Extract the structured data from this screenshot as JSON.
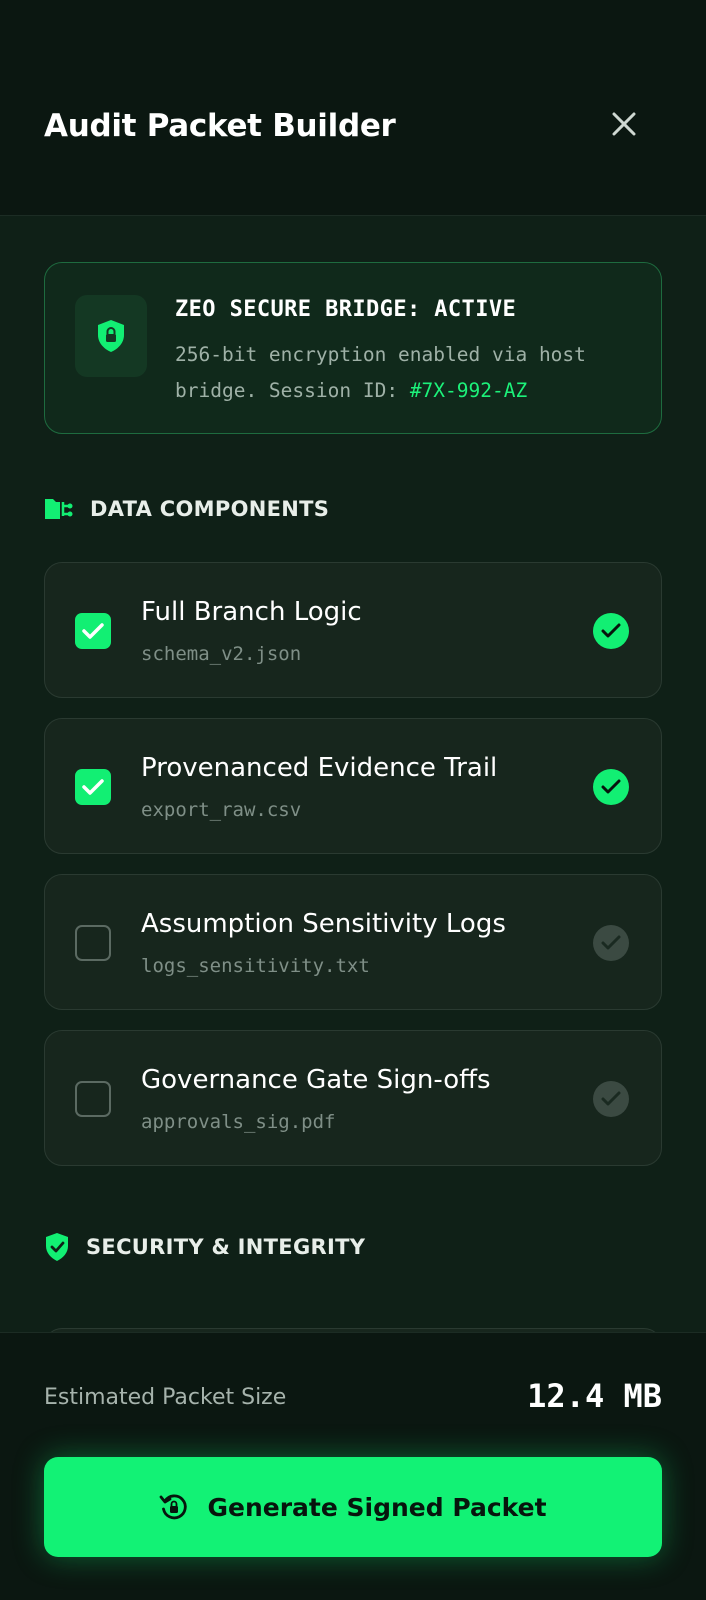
{
  "header": {
    "title": "Audit Packet Builder",
    "close_icon": "close-icon"
  },
  "bridge": {
    "title": "ZEO SECURE BRIDGE: ACTIVE",
    "description": "256-bit encryption enabled via host bridge. Session ID: ",
    "session_id": "#7X-992-AZ",
    "icon": "shield-lock-icon"
  },
  "sections": {
    "data_components": {
      "label": "DATA COMPONENTS",
      "icon": "folder-tree-icon"
    },
    "security": {
      "label": "SECURITY & INTEGRITY",
      "icon": "shield-check-icon"
    }
  },
  "components": [
    {
      "title": "Full Branch Logic",
      "file": "schema_v2.json",
      "checked": true
    },
    {
      "title": "Provenanced Evidence Trail",
      "file": "export_raw.csv",
      "checked": true
    },
    {
      "title": "Assumption Sensitivity Logs",
      "file": "logs_sensitivity.txt",
      "checked": false
    },
    {
      "title": "Governance Gate Sign-offs",
      "file": "approvals_sig.pdf",
      "checked": false
    }
  ],
  "footer": {
    "estimate_label": "Estimated Packet Size",
    "estimate_value": "12.4 MB",
    "button_label": "Generate Signed Packet",
    "button_icon": "history-lock-icon"
  },
  "colors": {
    "accent": "#12ef73",
    "background": "#0f2017",
    "card": "#17261d"
  }
}
